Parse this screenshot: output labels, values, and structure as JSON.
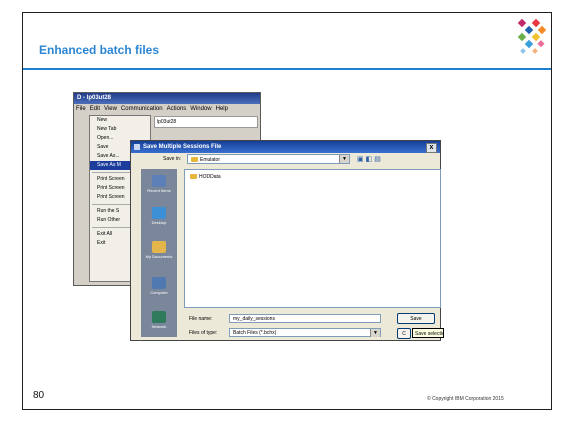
{
  "slide": {
    "title": "Enhanced batch files",
    "page_number": "80",
    "copyright": "© Copyright IBM Corporation 2015"
  },
  "emulator": {
    "title": "D - lp03ut28",
    "menubar": [
      "File",
      "Edit",
      "View",
      "Communication",
      "Actions",
      "Window",
      "Help"
    ],
    "session_field": "lp03ut28",
    "file_menu": [
      "New",
      "New Tab",
      "Open...",
      "Save",
      "Save As...",
      "Save As M",
      "Print Screen",
      "Print Screen",
      "Print Screen",
      "Run the S",
      "Run Other",
      "Exit All",
      "Exit"
    ],
    "selected_index": 5
  },
  "dialog": {
    "title": "Save Multiple Sessions File",
    "close_glyph": "x",
    "save_in_label": "Save in:",
    "save_in_value": "Emulator",
    "places": [
      "Recent Items",
      "Desktop",
      "My Documents",
      "Computer",
      "Network"
    ],
    "files": [
      "HODData"
    ],
    "file_name_label": "File name:",
    "file_name_value": "my_daily_sessions",
    "file_type_label": "Files of type:",
    "file_type_value": "Batch Files (*.bchx)",
    "save_button": "Save",
    "cancel_button": "C",
    "tooltip": "Save selection"
  },
  "colors": {
    "accent": "#2a86d3",
    "rule": "#1f7fd0",
    "titlebar": "#163f97"
  }
}
